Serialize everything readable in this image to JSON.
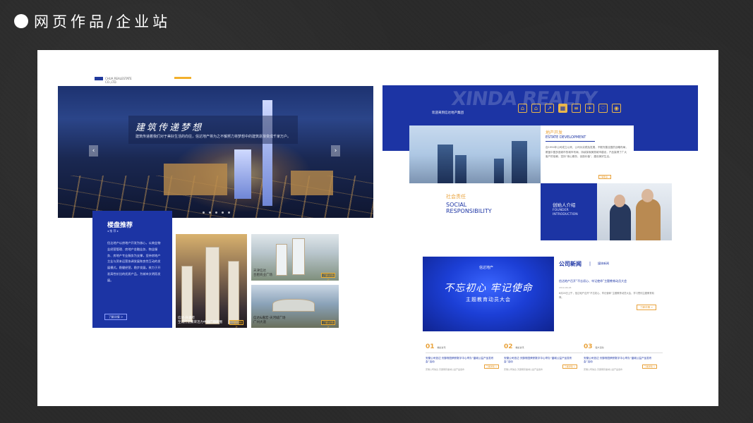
{
  "heading": {
    "title": "网页作品/企业站"
  },
  "left_site": {
    "logo_text": "CHUA REALESTATE CO.,LTD.",
    "nav": "",
    "hero": {
      "slogan": "建筑传递梦想",
      "sub": "建筑传递着我们对于美好生活的向往，信达地产将为之不懈努力将梦想中的建筑逐渐变成千家万户。",
      "prev": "‹",
      "next": "›"
    },
    "recommend": {
      "title": "楼盘推荐",
      "tag": "◂ 推 荐 ▸",
      "desc": "信达地产以房地产开发为核心，以商业物业经营管理、房地产金融业务、物业服务、房地产专业服务为支撑，坚持房地产主业与资本运营协调发展和良性互动的发展模式，稳健经营，稳步发展，致力于开发高性价比的优质产品，为城市文明而发展。",
      "more": "了解详情 >"
    },
    "photos": [
      {
        "caption": "信达·升浦府\n至诚打造繁荣活力中国广场商圈",
        "btn": "了解详情 >"
      },
      {
        "caption": "天津信达\n合肥商业广场",
        "btn": "了解详情 >"
      },
      {
        "caption": "信达&嘉宏·天河城广场\n广州大道",
        "btn": "了解详情 >"
      }
    ]
  },
  "right_site": {
    "watermark": "XINDA REALTY",
    "slogan": "欢迎来到信达地产集团",
    "icons": [
      "⌂",
      "⌂",
      "↗",
      "▦",
      "≡",
      "✈",
      "♡",
      "◉"
    ],
    "nav": [
      "",
      "",
      "",
      "",
      "",
      "",
      "",
      ""
    ],
    "estate": {
      "zh": "地产开发",
      "en": "ESTATE DEVELOPMENT",
      "desc": "自1994年公司成立以来，公司为实践及发展，不断完善全国的战略布局，覆盖中国多座城市的城市布局，持续探索美丽城市建设，产品赢得了广大客户的信赖，坚持“用心服务，创造价值”，建设美好生活。",
      "more": "了解更多 >"
    },
    "social": {
      "zh": "社会责任",
      "en1": "SOCIAL",
      "en2": "RESPONSIBILITY"
    },
    "founder": {
      "zh": "创始人介绍",
      "en1": "FOUNDER",
      "en2": "INTRODUCTION"
    },
    "news": {
      "img_logo": "信达地产",
      "img_big": "不忘初心 牢记使命",
      "img_sub": "主题教育动员大会",
      "title": "公司新闻",
      "sep": "|",
      "en": "媒体新闻",
      "headline": "信达地产召开“不忘初心、牢记使命”主题教育动员大会",
      "date": "2019-06-28",
      "desc": "6月28日上午，信达地产召开“不忘初心、牢记使命”主题教育动员大会，学习贯彻主题教育精神。",
      "more": "了解详情 >"
    },
    "items": [
      {
        "num": "01",
        "cat": "精彩资讯",
        "headline": "安徽公司信达·天御府园荣获数字中心举办“晶城公益产品发布会”活动",
        "sub": "安徽公司信达·天御荣获晶城公益产品发布",
        "btn": "了解详情 >"
      },
      {
        "num": "02",
        "cat": "精彩资讯",
        "headline": "安徽公司信达·天御府园荣获数字中心举办“晶城公益产品发布会”活动",
        "sub": "安徽公司信达·天御荣获晶城公益产品发布",
        "btn": "了解详情 >"
      },
      {
        "num": "03",
        "cat": "客户活动",
        "headline": "安徽公司信达·天御府园荣获数字中心举办“晶城公益产品发布会”活动",
        "sub": "安徽公司信达·天御荣获晶城公益产品发布",
        "btn": "了解详情 >"
      }
    ]
  }
}
